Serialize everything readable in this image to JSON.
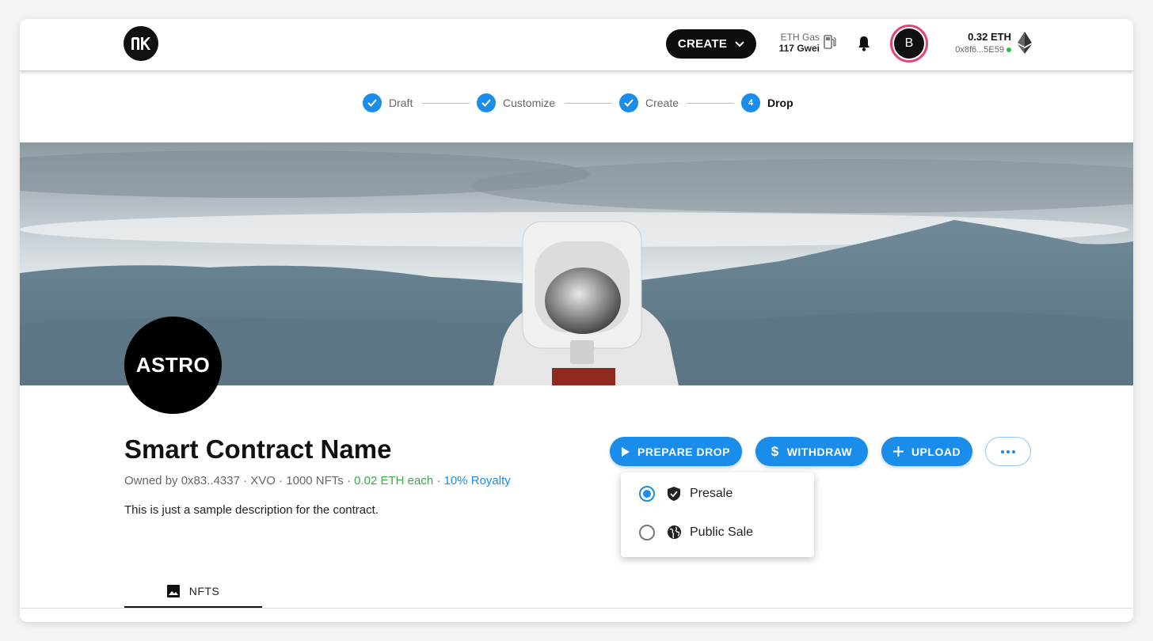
{
  "header": {
    "create_label": "CREATE",
    "gas_label": "ETH Gas",
    "gas_value": "117 Gwei",
    "avatar_initial": "B",
    "balance": "0.32 ETH",
    "address": "0x8f6...5E59"
  },
  "stepper": {
    "steps": [
      {
        "label": "Draft",
        "state": "done"
      },
      {
        "label": "Customize",
        "state": "done"
      },
      {
        "label": "Create",
        "state": "done"
      },
      {
        "label": "Drop",
        "state": "active",
        "number": "4"
      }
    ]
  },
  "contract": {
    "logo_text": "ASTRO",
    "name": "Smart Contract Name",
    "meta_owner": "Owned by 0x83..4337 · XVO · 1000 NFTs · ",
    "meta_price": "0.02 ETH each",
    "meta_sep": " · ",
    "meta_royalty": "10% Royalty",
    "description": "This is just a sample description for the contract."
  },
  "actions": {
    "prepare_drop": "PREPARE DROP",
    "withdraw": "WITHDRAW",
    "upload": "UPLOAD"
  },
  "drop_menu": {
    "items": [
      {
        "label": "Presale",
        "selected": true,
        "icon": "shield-icon"
      },
      {
        "label": "Public Sale",
        "selected": false,
        "icon": "globe-icon"
      }
    ]
  },
  "tabs": {
    "nfts": "NFTS"
  },
  "colors": {
    "primary": "#1a8cea",
    "dark": "#0d0d0d",
    "avatar_ring": "#e0457b",
    "price_green": "#3ba64a"
  }
}
